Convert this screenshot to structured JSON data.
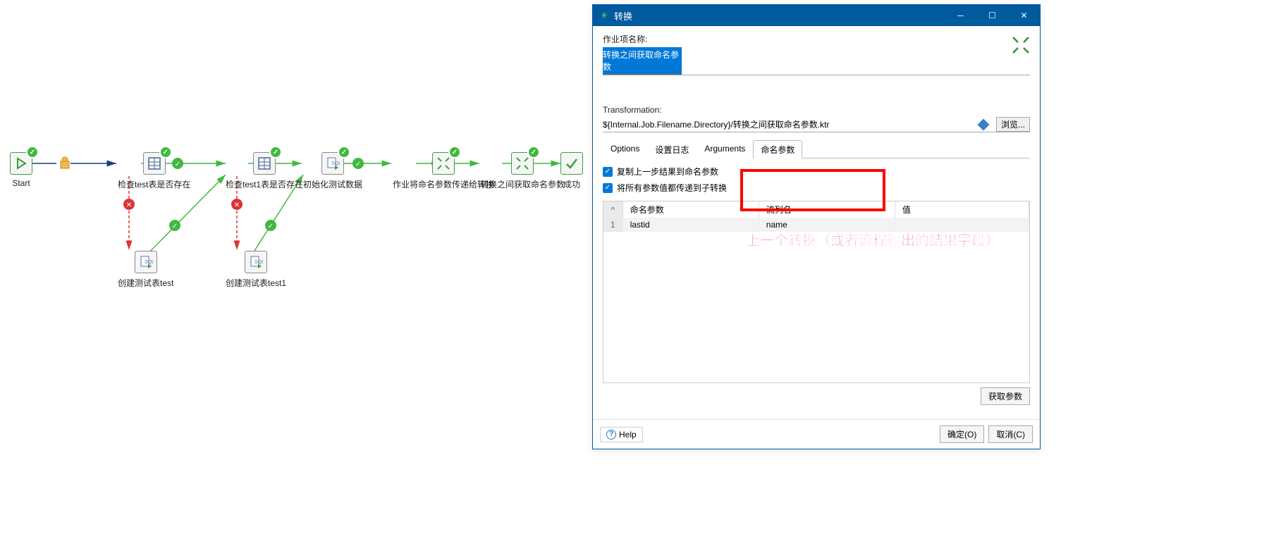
{
  "canvas": {
    "nodes": {
      "start": {
        "label": "Start"
      },
      "check_test": {
        "label": "检查test表是否存在"
      },
      "check_test1": {
        "label": "检查test1表是否存在"
      },
      "init_data": {
        "label": "初始化测试数据"
      },
      "job_params": {
        "label": "作业将命名参数传递给转换"
      },
      "trans_params": {
        "label": "转换之间获取命名参数"
      },
      "success": {
        "label": "成功"
      },
      "create_test": {
        "label": "创建测试表test"
      },
      "create_test1": {
        "label": "创建测试表test1"
      }
    }
  },
  "dialog": {
    "title": "转换",
    "name_label": "作业项名称:",
    "name_value": "转换之间获取命名参数",
    "trans_label": "Transformation:",
    "trans_value": "${Internal.Job.Filename.Directory}/转换之间获取命名参数.ktr",
    "browse": "浏览...",
    "tabs": {
      "options": "Options",
      "log": "设置日志",
      "args": "Arguments",
      "params": "命名参数"
    },
    "copy_prev": "复制上一步结果到命名参数",
    "pass_all": "将所有参数值都传递到子转换",
    "table": {
      "col1": "命名参数",
      "col2": "流列名",
      "col3": "值",
      "r1": {
        "p": "lastid",
        "s": "name",
        "v": ""
      }
    },
    "get_params": "获取参数",
    "help": "Help",
    "ok": "确定(O)",
    "cancel": "取消(C)"
  },
  "annotation": "上一个转换（或者流程输出的结果字段）"
}
